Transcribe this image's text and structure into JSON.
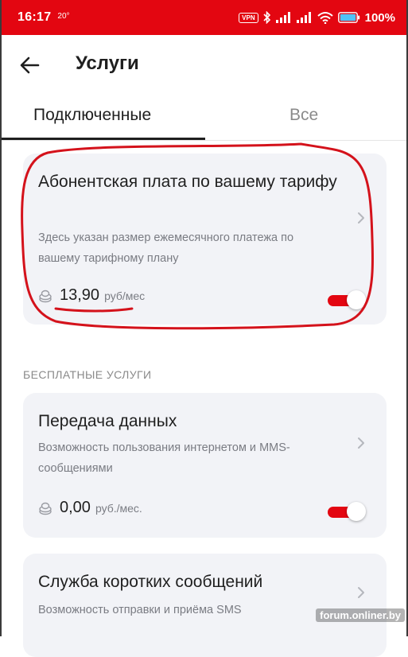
{
  "status_bar": {
    "time": "16:17",
    "temperature": "20°",
    "vpn_label": "VPN",
    "battery": "100%",
    "background_color": "#e30611",
    "icons": [
      "bluetooth-icon",
      "signal-icon",
      "signal-icon",
      "wifi-icon",
      "battery-icon"
    ]
  },
  "header": {
    "back_icon": "arrow-left-icon",
    "title": "Услуги"
  },
  "tabs": [
    {
      "label": "Подключенные",
      "active": true
    },
    {
      "label": "Все",
      "active": false
    }
  ],
  "paid_service": {
    "title": "Абонентская плата по вашему тарифу",
    "description": "Здесь указан размер ежемесячного платежа по вашему тарифному плану",
    "price": "13,90",
    "unit": "руб/мес",
    "enabled": true
  },
  "section_free": {
    "title": "БЕСПЛАТНЫЕ УСЛУГИ"
  },
  "free_services": [
    {
      "title": "Передача данных",
      "description": "Возможность пользования интернетом и MMS-сообщениями",
      "price": "0,00",
      "unit": "руб./мес.",
      "enabled": true
    },
    {
      "title": "Служба коротких сообщений",
      "description": "Возможность отправки и приёма SMS"
    }
  ],
  "watermark": "forum.onliner.by",
  "colors": {
    "accent": "#e30611",
    "annotation": "#d4121b",
    "card_bg": "#f2f3f7"
  }
}
